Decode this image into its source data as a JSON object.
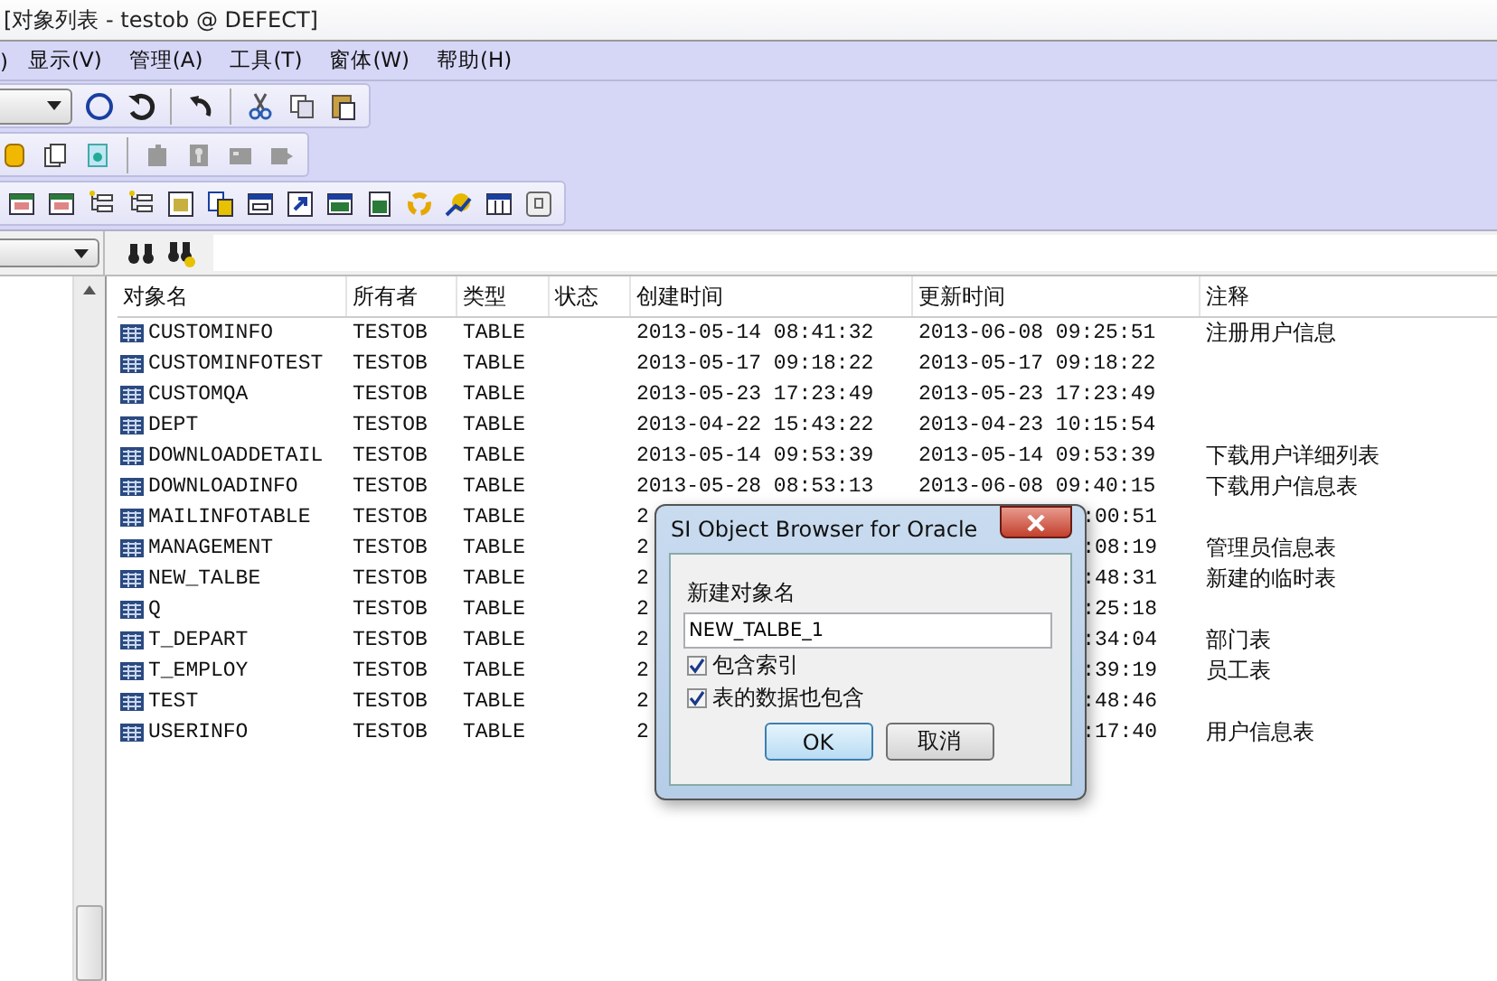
{
  "window": {
    "title": "[对象列表 - testob @ DEFECT]"
  },
  "menu": [
    {
      "label": ")"
    },
    {
      "label": "显示(V)"
    },
    {
      "label": "管理(A)"
    },
    {
      "label": "工具(T)"
    },
    {
      "label": "窗体(W)"
    },
    {
      "label": "帮助(H)"
    }
  ],
  "table": {
    "columns": [
      "对象名",
      "所有者",
      "类型",
      "状态",
      "创建时间",
      "更新时间",
      "注释"
    ],
    "rows": [
      {
        "name": "CUSTOMINFO",
        "owner": "TESTOB",
        "type": "TABLE",
        "created": "2013-05-14 08:41:32",
        "updated": "2013-06-08 09:25:51",
        "comment": "注册用户信息"
      },
      {
        "name": "CUSTOMINFOTEST",
        "owner": "TESTOB",
        "type": "TABLE",
        "created": "2013-05-17 09:18:22",
        "updated": "2013-05-17 09:18:22"
      },
      {
        "name": "CUSTOMQA",
        "owner": "TESTOB",
        "type": "TABLE",
        "created": "2013-05-23 17:23:49",
        "updated": "2013-05-23 17:23:49"
      },
      {
        "name": "DEPT",
        "owner": "TESTOB",
        "type": "TABLE",
        "created": "2013-04-22 15:43:22",
        "updated": "2013-04-23 10:15:54"
      },
      {
        "name": "DOWNLOADDETAIL",
        "owner": "TESTOB",
        "type": "TABLE",
        "created": "2013-05-14 09:53:39",
        "updated": "2013-05-14 09:53:39",
        "comment": "下载用户详细列表"
      },
      {
        "name": "DOWNLOADINFO",
        "owner": "TESTOB",
        "type": "TABLE",
        "created": "2013-05-28 08:53:13",
        "updated": "2013-06-08 09:40:15",
        "comment": "下载用户信息表"
      },
      {
        "name": "MAILINFOTABLE",
        "owner": "TESTOB",
        "type": "TABLE",
        "created": "2",
        "updated": ":00:51"
      },
      {
        "name": "MANAGEMENT",
        "owner": "TESTOB",
        "type": "TABLE",
        "created": "2",
        "updated": ":08:19",
        "comment": "管理员信息表"
      },
      {
        "name": "NEW_TALBE",
        "owner": "TESTOB",
        "type": "TABLE",
        "created": "2",
        "updated": ":48:31",
        "comment": "新建的临时表"
      },
      {
        "name": "Q",
        "owner": "TESTOB",
        "type": "TABLE",
        "created": "2",
        "updated": ":25:18"
      },
      {
        "name": "T_DEPART",
        "owner": "TESTOB",
        "type": "TABLE",
        "created": "2",
        "updated": ":34:04",
        "comment": "部门表"
      },
      {
        "name": "T_EMPLOY",
        "owner": "TESTOB",
        "type": "TABLE",
        "created": "2",
        "updated": ":39:19",
        "comment": "员工表"
      },
      {
        "name": "TEST",
        "owner": "TESTOB",
        "type": "TABLE",
        "created": "2",
        "updated": ":48:46"
      },
      {
        "name": "USERINFO",
        "owner": "TESTOB",
        "type": "TABLE",
        "created": "2",
        "updated": ":17:40",
        "comment": "用户信息表"
      }
    ]
  },
  "dialog": {
    "title": "SI Object Browser for Oracle",
    "label": "新建对象名",
    "value": "NEW_TALBE_1",
    "checkboxes": [
      {
        "label": "包含索引",
        "checked": true
      },
      {
        "label": "表的数据也包含",
        "checked": true
      }
    ],
    "buttons": [
      {
        "label": "OK",
        "default": true
      },
      {
        "label": "取消",
        "default": false
      }
    ]
  }
}
